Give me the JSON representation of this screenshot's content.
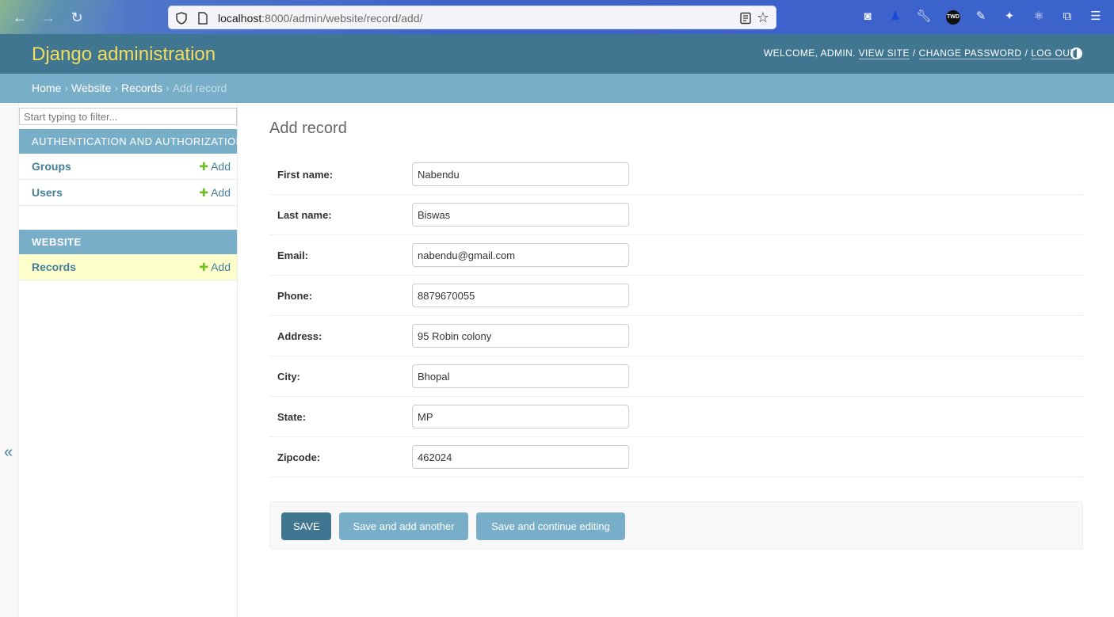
{
  "browser": {
    "url_host": "localhost",
    "url_rest": ":8000/admin/website/record/add/"
  },
  "header": {
    "site_name": "Django administration",
    "welcome": "WELCOME, ADMIN.",
    "view_site": "VIEW SITE",
    "change_password": "CHANGE PASSWORD",
    "log_out": "LOG OUT",
    "separator": "/"
  },
  "breadcrumbs": {
    "home": "Home",
    "app": "Website",
    "model": "Records",
    "current": "Add record",
    "arrow": "›"
  },
  "sidebar": {
    "filter_placeholder": "Start typing to filter...",
    "collapse_glyph": "«",
    "modules": [
      {
        "caption": "AUTHENTICATION AND AUTHORIZATION",
        "rows": [
          {
            "label": "Groups",
            "add": "Add"
          },
          {
            "label": "Users",
            "add": "Add"
          }
        ]
      },
      {
        "caption": "WEBSITE",
        "rows": [
          {
            "label": "Records",
            "add": "Add"
          }
        ]
      }
    ]
  },
  "content": {
    "title": "Add record",
    "fields": [
      {
        "label": "First name:",
        "value": "Nabendu"
      },
      {
        "label": "Last name:",
        "value": "Biswas"
      },
      {
        "label": "Email:",
        "value": "nabendu@gmail.com"
      },
      {
        "label": "Phone:",
        "value": "8879670055"
      },
      {
        "label": "Address:",
        "value": "95 Robin colony"
      },
      {
        "label": "City:",
        "value": "Bhopal"
      },
      {
        "label": "State:",
        "value": "MP"
      },
      {
        "label": "Zipcode:",
        "value": "462024"
      }
    ],
    "buttons": {
      "save": "SAVE",
      "save_add_another": "Save and add another",
      "save_continue": "Save and continue editing"
    }
  },
  "colors": {
    "header_bg": "#417690",
    "site_name": "#f5dd5d",
    "breadcrumb_bg": "#79aec8",
    "current_row_bg": "#ffffcc",
    "add_plus": "#70bf2b"
  }
}
